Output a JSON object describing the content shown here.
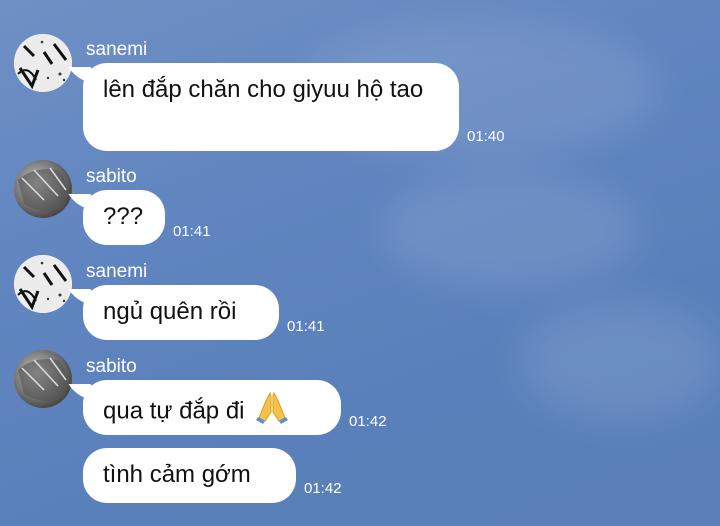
{
  "messages": [
    {
      "sender": "sanemi",
      "text": "lên đắp chăn cho giyuu hộ tao",
      "time": "01:40"
    },
    {
      "sender": "sabito",
      "text": "???",
      "time": "01:41"
    },
    {
      "sender": "sanemi",
      "text": "ngủ quên rồi",
      "time": "01:41"
    },
    {
      "sender": "sabito",
      "text": "qua tự đắp đi",
      "emoji": "folded-hands",
      "time": "01:42"
    },
    {
      "sender": "",
      "text": "tình cảm gớm",
      "time": "01:42"
    }
  ],
  "colors": {
    "background": "#5f84bf",
    "bubble": "#ffffff",
    "text": "#111111",
    "meta_text": "#ffffff"
  }
}
